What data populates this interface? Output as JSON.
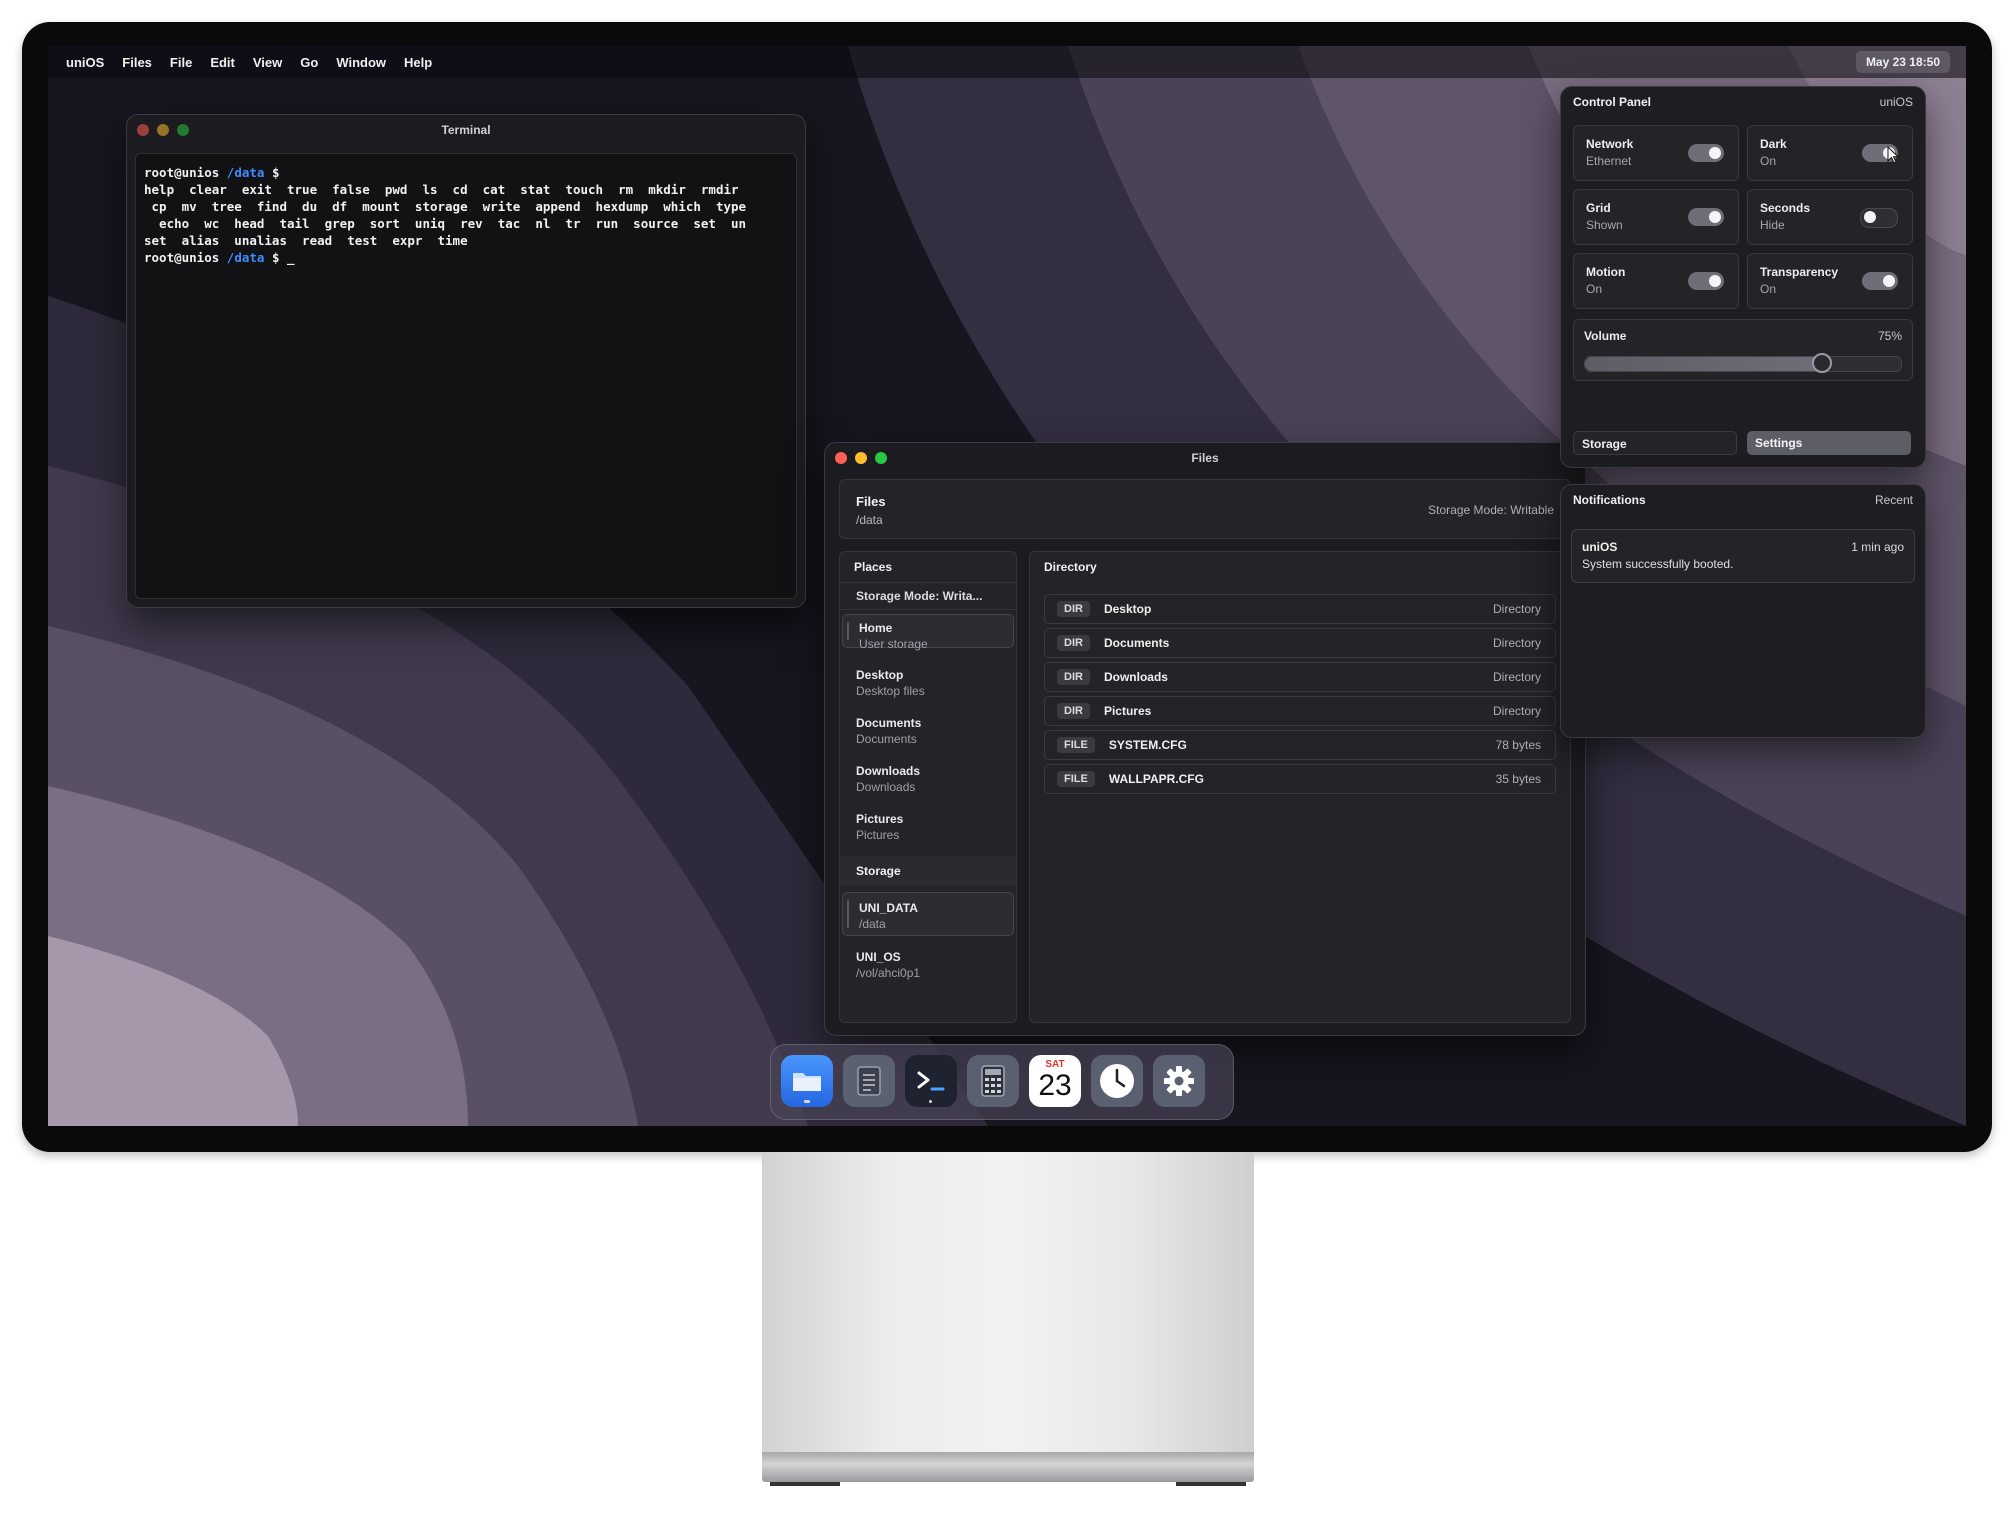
{
  "menubar": {
    "items": [
      "uniOS",
      "Files",
      "File",
      "Edit",
      "View",
      "Go",
      "Window",
      "Help"
    ],
    "clock": "May 23  18:50"
  },
  "terminal": {
    "title": "Terminal",
    "prompt_user": "root@unios",
    "prompt_path": "/data",
    "prompt_symbol": "$",
    "output": "help  clear  exit  true  false  pwd  ls  cd  cat  stat  touch  rm  mkdir  rmdir\n cp  mv  tree  find  du  df  mount  storage  write  append  hexdump  which  type\n  echo  wc  head  tail  grep  sort  uniq  rev  tac  nl  tr  run  source  set  un\nset  alias  unalias  read  test  expr  time",
    "cursor": "_"
  },
  "files": {
    "title": "Files",
    "header_title": "Files",
    "header_path": "/data",
    "storage_mode": "Storage Mode: Writable",
    "places_title": "Places",
    "places_mode": "Storage Mode: Writa...",
    "places": [
      {
        "name": "Home",
        "sub": "User storage"
      },
      {
        "name": "Desktop",
        "sub": "Desktop files"
      },
      {
        "name": "Documents",
        "sub": "Documents"
      },
      {
        "name": "Downloads",
        "sub": "Downloads"
      },
      {
        "name": "Pictures",
        "sub": "Pictures"
      }
    ],
    "storage_title": "Storage",
    "volumes": [
      {
        "name": "UNI_DATA",
        "sub": "/data"
      },
      {
        "name": "UNI_OS",
        "sub": "/vol/ahci0p1"
      }
    ],
    "directory_title": "Directory",
    "entries": [
      {
        "badge": "DIR",
        "name": "Desktop",
        "kind": "Directory"
      },
      {
        "badge": "DIR",
        "name": "Documents",
        "kind": "Directory"
      },
      {
        "badge": "DIR",
        "name": "Downloads",
        "kind": "Directory"
      },
      {
        "badge": "DIR",
        "name": "Pictures",
        "kind": "Directory"
      },
      {
        "badge": "FILE",
        "name": "SYSTEM.CFG",
        "kind": "78 bytes"
      },
      {
        "badge": "FILE",
        "name": "WALLPAPR.CFG",
        "kind": "35 bytes"
      }
    ]
  },
  "control_panel": {
    "title": "Control Panel",
    "brand": "uniOS",
    "tiles": [
      {
        "label": "Network",
        "status": "Ethernet",
        "on": true
      },
      {
        "label": "Dark",
        "status": "On",
        "on": true
      },
      {
        "label": "Grid",
        "status": "Shown",
        "on": true
      },
      {
        "label": "Seconds",
        "status": "Hide",
        "on": false
      },
      {
        "label": "Motion",
        "status": "On",
        "on": true
      },
      {
        "label": "Transparency",
        "status": "On",
        "on": true
      }
    ],
    "volume_label": "Volume",
    "volume_text": "75%",
    "volume_level": 0.75,
    "storage_button": "Storage",
    "settings_button": "Settings"
  },
  "notifications": {
    "title": "Notifications",
    "filter": "Recent",
    "items": [
      {
        "app": "uniOS",
        "time": "1 min ago",
        "message": "System successfully booted."
      }
    ]
  },
  "dock": {
    "calendar_day": "SAT",
    "calendar_date": "23",
    "icons": [
      "folder-icon",
      "notes-icon",
      "terminal-icon",
      "calculator-icon",
      "calendar-icon",
      "clock-icon",
      "settings-gear-icon"
    ],
    "accent": "#2f7cf6"
  }
}
